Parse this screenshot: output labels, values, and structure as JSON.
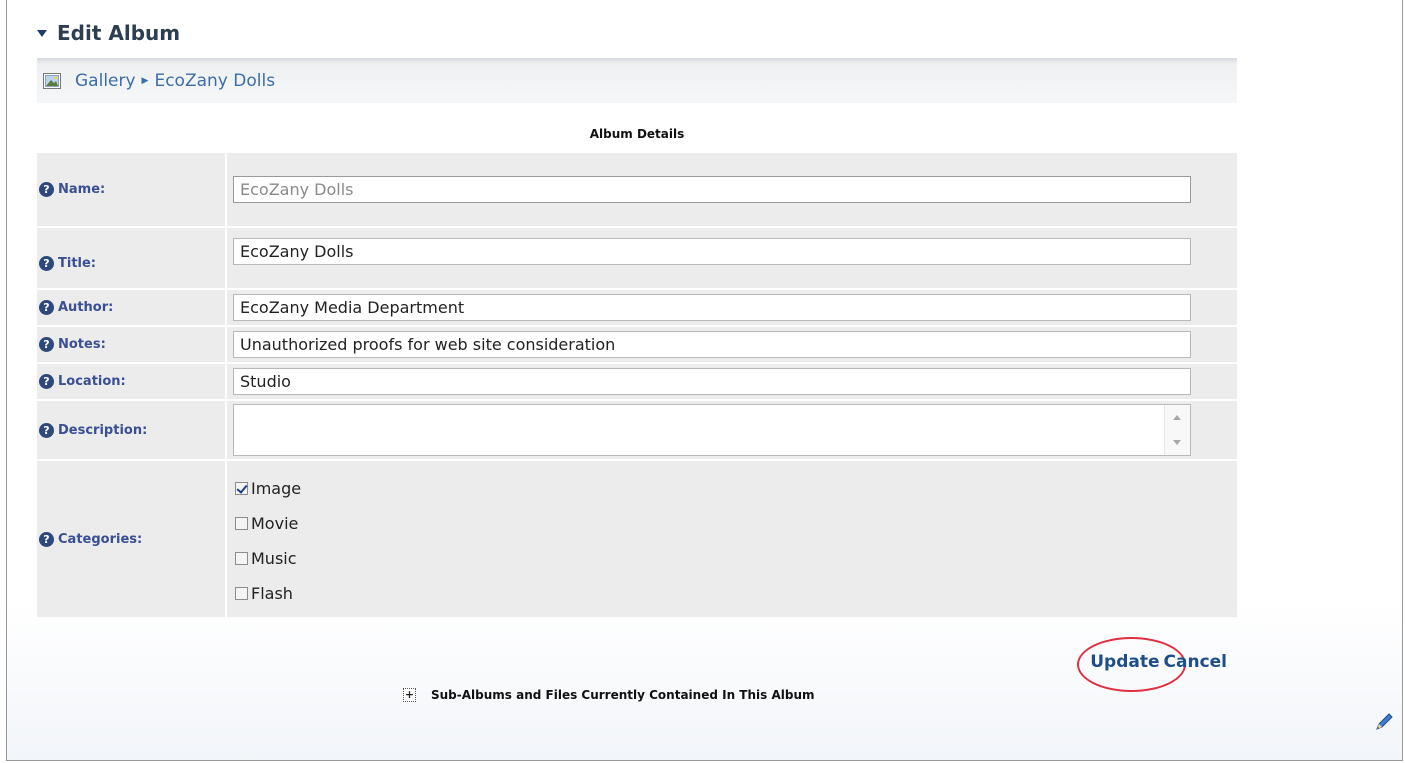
{
  "section": {
    "title": "Edit Album"
  },
  "breadcrumb": {
    "items": [
      "Gallery",
      "EcoZany Dolls"
    ],
    "icon": "gallery-icon"
  },
  "album_details": {
    "heading": "Album Details"
  },
  "fields": {
    "name": {
      "label": "Name:",
      "value": "EcoZany Dolls"
    },
    "title": {
      "label": "Title:",
      "value": "EcoZany Dolls"
    },
    "author": {
      "label": "Author:",
      "value": "EcoZany Media Department"
    },
    "notes": {
      "label": "Notes:",
      "value": "Unauthorized proofs for web site consideration"
    },
    "location": {
      "label": "Location:",
      "value": "Studio"
    },
    "description": {
      "label": "Description:",
      "value": ""
    },
    "categories": {
      "label": "Categories:"
    }
  },
  "categories": [
    {
      "label": "Image",
      "checked": true
    },
    {
      "label": "Movie",
      "checked": false
    },
    {
      "label": "Music",
      "checked": false
    },
    {
      "label": "Flash",
      "checked": false
    }
  ],
  "help_icon_glyph": "?",
  "actions": {
    "update_label": "Update",
    "cancel_label": "Cancel"
  },
  "subalbums": {
    "toggle_glyph": "+",
    "label": "Sub-Albums and Files Currently Contained In This Album"
  },
  "colors": {
    "link": "#3d6da8",
    "label": "#3a4e94",
    "row_bg": "#ececec",
    "highlight_ring": "#e03040"
  }
}
